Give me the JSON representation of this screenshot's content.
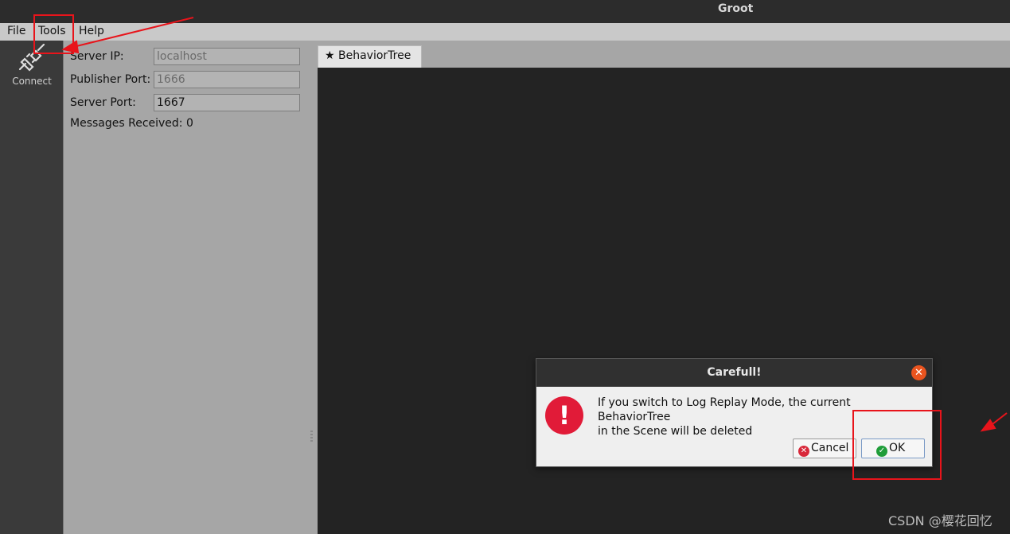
{
  "window": {
    "title": "Groot"
  },
  "menu": {
    "file": "File",
    "tools": "Tools",
    "help": "Help"
  },
  "toolbar": {
    "connect_label": "Connect"
  },
  "monitor_panel": {
    "server_ip_label": "Server IP:",
    "server_ip_value": "localhost",
    "publisher_port_label": "Publisher Port:",
    "publisher_port_value": "1666",
    "server_port_label": "Server Port:",
    "server_port_value": "1667",
    "messages_received": "Messages Received: 0"
  },
  "tabs": [
    {
      "label": "BehaviorTree",
      "icon": "star-icon"
    }
  ],
  "dialog": {
    "title": "Carefull!",
    "message_line1": "If you switch to Log Replay Mode, the current BehaviorTree",
    "message_line2": "in the Scene will be deleted",
    "cancel_label": "Cancel",
    "ok_label": "OK"
  },
  "colors": {
    "annotation": "#e8141b",
    "warning": "#e11b38",
    "close": "#e9541f",
    "ok_check": "#1f9d3a"
  },
  "watermark": "CSDN @樱花回忆"
}
